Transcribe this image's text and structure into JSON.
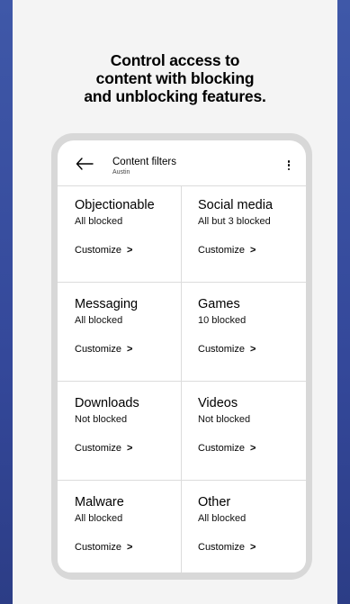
{
  "headline": {
    "line1": "Control access to",
    "line2": "content with blocking",
    "line3": "and unblocking features."
  },
  "header": {
    "title": "Content filters",
    "subtitle": "Austin",
    "back_icon": "arrow-left-icon",
    "menu_icon": "more-vertical-icon"
  },
  "filters": [
    {
      "name": "Objectionable",
      "status": "All blocked",
      "action": "Customize",
      "chevron": ">"
    },
    {
      "name": "Social media",
      "status": "All but 3 blocked",
      "action": "Customize",
      "chevron": ">"
    },
    {
      "name": "Messaging",
      "status": "All blocked",
      "action": "Customize",
      "chevron": ">"
    },
    {
      "name": "Games",
      "status": "10 blocked",
      "action": "Customize",
      "chevron": ">"
    },
    {
      "name": "Downloads",
      "status": "Not blocked",
      "action": "Customize",
      "chevron": ">"
    },
    {
      "name": "Videos",
      "status": "Not blocked",
      "action": "Customize",
      "chevron": ">"
    },
    {
      "name": "Malware",
      "status": "All blocked",
      "action": "Customize",
      "chevron": ">"
    },
    {
      "name": "Other",
      "status": "All blocked",
      "action": "Customize",
      "chevron": ">"
    }
  ],
  "colors": {
    "background": "#34489a",
    "card": "#f4f4f4",
    "phone_frame": "#d8d8d8",
    "screen": "#ffffff"
  }
}
